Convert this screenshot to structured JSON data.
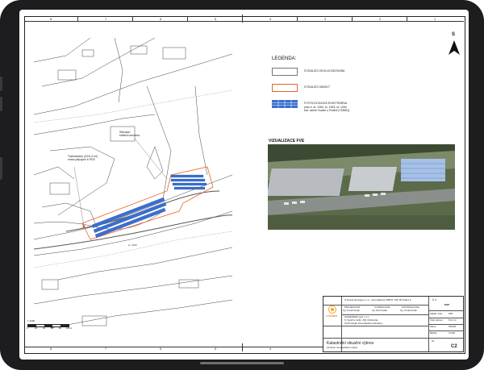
{
  "ruler": {
    "top": [
      "8",
      "7",
      "6",
      "5",
      "4",
      "3",
      "2",
      "1"
    ],
    "bottom": [
      "8",
      "7",
      "6",
      "5",
      "4",
      "3",
      "2",
      "1"
    ]
  },
  "map_labels": {
    "substation": "Stávající\nelektrorozvodna",
    "transformer": "Trafostanice (22/0,4 kV)\nmísto připojení k PDS",
    "road": "st. 1260"
  },
  "legend": {
    "title": "LEGENDA:",
    "items": [
      {
        "text": "STÁVAJÍCÍ OKOLNÍ ZÁSTAVBA"
      },
      {
        "text": "STÁVAJÍCÍ OBJEKT"
      },
      {
        "text": "FOTOVOLTAICKÁ ELEKTRÁRNA\nparc.č. st. 1260, st. 1263, st. 1264\nkat. území Hudce u Rudné [733652]"
      }
    ]
  },
  "visualization": {
    "title": "VIZUALIZACE FVE"
  },
  "north": {
    "label": "S"
  },
  "scale": {
    "ratio": "1:1000",
    "ticks": [
      "0",
      "20",
      "40",
      "60",
      "80",
      "100 m"
    ]
  },
  "title_block": {
    "company": "S-Power Energies s.r.o., Jeremiášova 2581/5, 155 00 Praha 5",
    "logo_text": "S-POWER",
    "stage_label": "Č.V.",
    "stage_value": "DSP",
    "roles": [
      "PROJEKTANT",
      "VYPRACOVAL",
      "KONTROLOVAL"
    ],
    "names": [
      "Ing. Tomáš Novák",
      "Ing. Petr Dvořák",
      "Ing. Tomáš Novák"
    ],
    "investor": [
      "SCHENKER spol. s r.o.",
      "K Vypichu 1211, 252 19 Rudná",
      "Technologie fotovoltaické elektrárny"
    ],
    "meta_labels": [
      "Zakázk. číslo",
      "Číslo výkresu",
      "Datum",
      "Měřítko"
    ],
    "meta_values": [
      "DSP",
      "FV-1.C2",
      "05/2023",
      "1:1000"
    ],
    "drawing_title": "Katastrální situační výkres",
    "drawing_subtitle": "(Ortofoto na katastrálnu mapu)",
    "format_label": "A1",
    "sheet_label": "C2"
  }
}
